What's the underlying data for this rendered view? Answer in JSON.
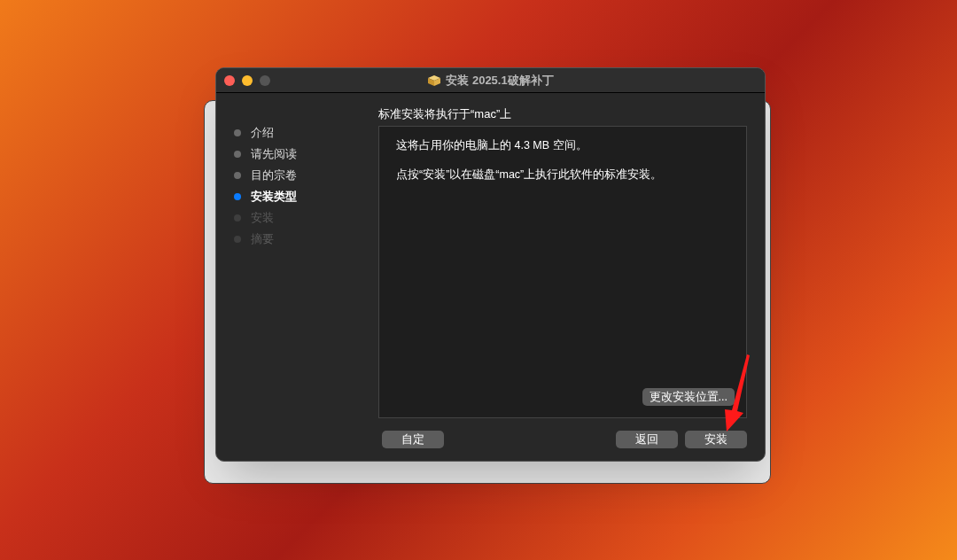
{
  "window": {
    "title": "安装 2025.1破解补丁"
  },
  "steps": [
    {
      "label": "介绍",
      "selected": false,
      "disabled": false
    },
    {
      "label": "请先阅读",
      "selected": false,
      "disabled": false
    },
    {
      "label": "目的宗卷",
      "selected": false,
      "disabled": false
    },
    {
      "label": "安装类型",
      "selected": true,
      "disabled": false
    },
    {
      "label": "安装",
      "selected": false,
      "disabled": true
    },
    {
      "label": "摘要",
      "selected": false,
      "disabled": true
    }
  ],
  "heading": "标准安装将执行于“mac”上",
  "panel": {
    "paragraphs": [
      "这将占用你的电脑上的 4.3 MB 空间。",
      "点按“安装”以在磁盘“mac”上执行此软件的标准安装。"
    ],
    "change_location_button": "更改安装位置..."
  },
  "buttons": {
    "customize": "自定",
    "back": "返回",
    "install": "安装"
  }
}
